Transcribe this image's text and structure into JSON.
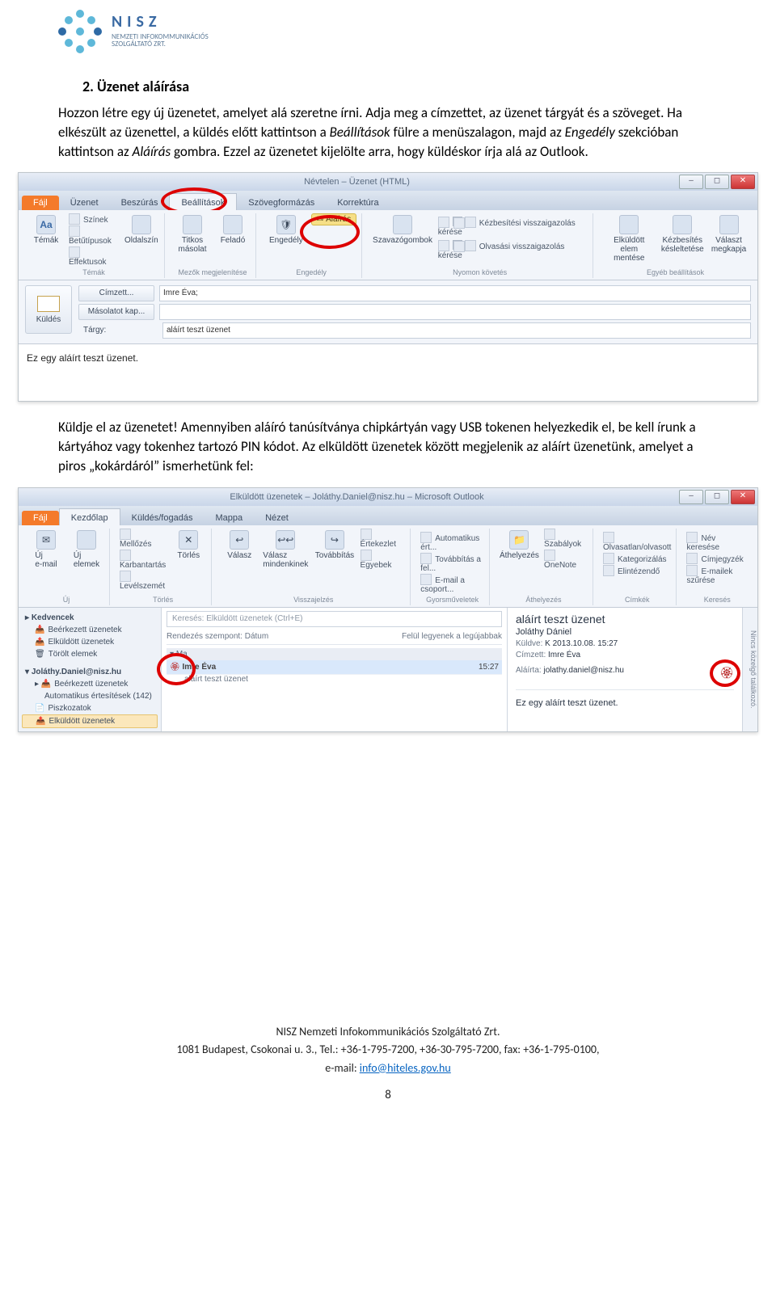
{
  "logo": {
    "title": "NISZ",
    "sub1": "NEMZETI INFOKOMMUNIKÁCIÓS",
    "sub2": "SZOLGÁLTATÓ ZRT."
  },
  "heading": "2.   Üzenet aláírása",
  "para1_a": "Hozzon létre egy új üzenetet, amelyet alá szeretne írni. Adja meg a címzettet, az üzenet tárgyát és a szöveget. Ha elkészült az üzenettel, a küldés előtt kattintson a ",
  "para1_b": " fülre a menüszalagon, majd az ",
  "para1_c": " szekcióban kattintson az ",
  "para1_d": " gombra. Ezzel az üzenetet kijelölte arra, hogy küldéskor írja alá az Outlook.",
  "italic1": "Beállítások",
  "italic2": "Engedély",
  "italic3": "Aláírás",
  "shot1": {
    "title": "Névtelen – Üzenet (HTML)",
    "fileTab": "Fájl",
    "tabs": [
      "Üzenet",
      "Beszúrás",
      "Beállítások",
      "Szövegformázás",
      "Korrektúra"
    ],
    "group_temak": "Témák",
    "opt_szinek": "Színek",
    "opt_betutip": "Betűtípusok",
    "opt_effekt": "Effektusok",
    "btn_temak": "Témák",
    "btn_oldalszin": "Oldalszín",
    "group_mezok": "Mezők megjelenítése",
    "btn_titkos": "Titkos\nmásolat",
    "btn_felado": "Feladó",
    "group_engedely": "Engedély",
    "btn_engedely": "Engedély",
    "btn_alairas": "Aláírás",
    "group_nyomon": "Nyomon követés",
    "btn_szavazo": "Szavazógombok",
    "chk_kezb": "Kézbesítési visszaigazolás kérése",
    "chk_olv": "Olvasási visszaigazolás kérése",
    "group_egyeb": "Egyéb beállítások",
    "btn_elkuldott": "Elküldött elem\nmentése",
    "btn_kezbesites": "Kézbesítés\nkésleltetése",
    "btn_valaszt": "Választ\nmegkapja",
    "send": "Küldés",
    "to_btn": "Címzett...",
    "cc_btn": "Másolatot kap...",
    "subj_lbl": "Tárgy:",
    "to_val": "Imre Éva;",
    "subj_val": "aláírt teszt üzenet",
    "body": "Ez egy aláírt teszt üzenet."
  },
  "para2": "Küldje el az üzenetet! Amennyiben aláíró tanúsítványa chipkártyán vagy USB tokenen helyezkedik el, be kell írunk a kártyához vagy tokenhez tartozó PIN kódot. Az elküldött üzenetek között megjelenik az aláírt üzenetünk, amelyet a piros „kokárdáról” ismerhetünk fel:",
  "shot2": {
    "title": "Elküldött üzenetek – Joláthy.Daniel@nisz.hu – Microsoft Outlook",
    "fileTab": "Fájl",
    "tabs": [
      "Kezdőlap",
      "Küldés/fogadás",
      "Mappa",
      "Nézet"
    ],
    "r_uj": "Új\ne-mail",
    "r_ujelemek": "Új\nelemek",
    "r_melloz": "Mellőzés",
    "r_karbantart": "Karbantartás",
    "r_levelszemet": "Levélszemét",
    "r_torles": "Törlés",
    "r_valasz": "Válasz",
    "r_valaszmind": "Válasz\nmindenkinek",
    "r_tovabbitas": "Továbbítás",
    "r_egyebek": "Egyebek",
    "r_ertekezlet": "Értekezlet",
    "r_auto": "Automatikus ért...",
    "r_tovabbfel": "Továbbítás a fel...",
    "r_email_csop": "E-mail a csoport...",
    "g_gyors": "Gyorsműveletek",
    "r_athelyezes": "Áthelyezés",
    "r_szabalyok": "Szabályok",
    "r_onenote": "OneNote",
    "g_athelyezes": "Áthelyezés",
    "r_olvasatlan": "Olvasatlan/olvasott",
    "r_kategoria": "Kategorizálás",
    "r_elintezendo": "Elintézendő",
    "g_cimkek": "Címkék",
    "r_nevkereses": "Név keresése",
    "r_cimjegyzek": "Címjegyzék",
    "r_szures": "E-mailek szűrése",
    "nav_kedvencek": "Kedvencek",
    "nav_beerk": "Beérkezett üzenetek",
    "nav_elkuld": "Elküldött üzenetek",
    "nav_torolt": "Törölt elemek",
    "nav_account": "Joláthy.Daniel@nisz.hu",
    "nav_beerk2": "Beérkezett üzenetek",
    "nav_auto": "Automatikus értesítések (142)",
    "nav_piszkozat": "Piszkozatok",
    "nav_elkuld2": "Elküldött üzenetek",
    "search_ph": "Keresés: Elküldött üzenetek (Ctrl+E)",
    "sort_by": "Rendezés szempont: Dátum",
    "sort_new": "Felül legyenek a legújabbak",
    "day_ma": "Ma",
    "row_name": "Imre Éva",
    "row_subj": "aláírt teszt üzenet",
    "row_time": "15:27",
    "pv_subj": "aláírt teszt üzenet",
    "pv_name": "Joláthy Dániel",
    "pv_date": "K 2013.10.08. 15:27",
    "pv_to_lbl": "Címzett:",
    "pv_to": "Imre Éva",
    "pv_sign_lbl": "Aláírta:",
    "pv_sign": "jolathy.daniel@nisz.hu",
    "pv_body": "Ez egy aláírt teszt üzenet.",
    "side": "Nincs közelgő találkozó."
  },
  "footer": {
    "l1": "NISZ Nemzeti Infokommunikációs Szolgáltató Zrt.",
    "l2": "1081 Budapest, Csokonai u. 3., Tel.: +36-1-795-7200, +36-30-795-7200, fax: +36-1-795-0100,",
    "l3a": "e-mail: ",
    "l3b": "info@hiteles.gov.hu",
    "page": "8"
  }
}
